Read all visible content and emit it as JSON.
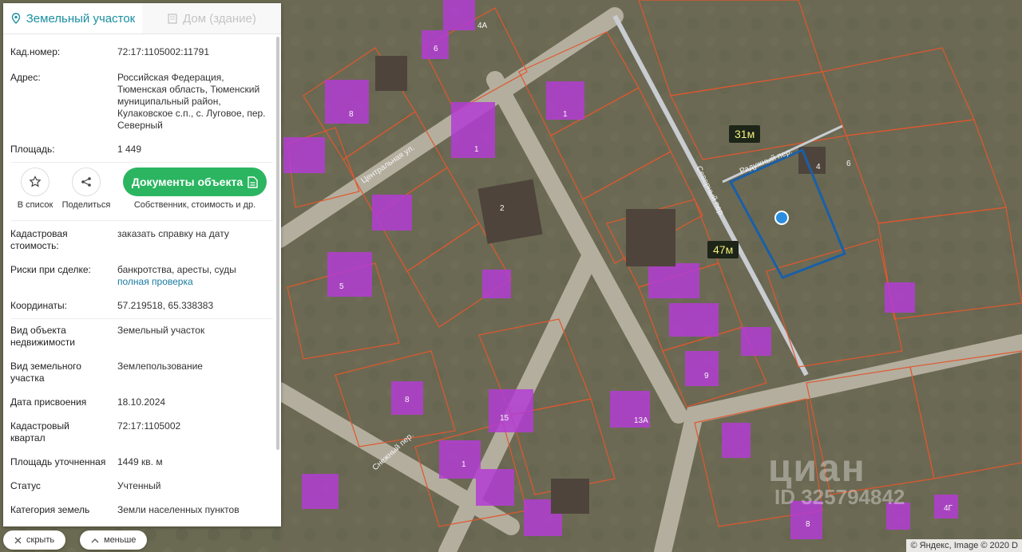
{
  "tabs": [
    {
      "label": "Земельный участок",
      "icon": "pin-icon",
      "active": true
    },
    {
      "label": "Дом (здание)",
      "icon": "building-icon",
      "active": false
    }
  ],
  "rows_top": [
    {
      "key": "Кад.номер:",
      "value": "72:17:1105002:11791",
      "link": true
    },
    {
      "key": "Адрес:",
      "value": "Российская Федерация, Тюменская область, Тюменский муниципальный район, Кулаковское с.п., с. Луговое, пер. Северный"
    },
    {
      "key": "Площадь:",
      "value": "1 449"
    }
  ],
  "actions": {
    "favorite_label": "В список",
    "share_label": "Поделиться",
    "documents_label": "Документы объекта",
    "documents_sub": "Собственник, стоимость и др."
  },
  "cadastral_value": {
    "key": "Кадастровая стоимость:",
    "link": "заказать справку на дату"
  },
  "risks": {
    "key": "Риски при сделке:",
    "value": "банкротства, аресты, суды",
    "link": "полная проверка"
  },
  "coords": {
    "key": "Координаты:",
    "value": "57.219518, 65.338383"
  },
  "rows_bottom": [
    {
      "key": "Вид объекта недвижимости",
      "value": "Земельный участок"
    },
    {
      "key": "Вид земельного участка",
      "value": "Землепользование"
    },
    {
      "key": "Дата присвоения",
      "value": "18.10.2024"
    },
    {
      "key": "Кадастровый квартал",
      "value": "72:17:1105002"
    },
    {
      "key": "Площадь уточненная",
      "value": "1449 кв. м"
    },
    {
      "key": "Статус",
      "value": "Учтенный"
    },
    {
      "key": "Категория земель",
      "value": "Земли населенных пунктов"
    }
  ],
  "controls": {
    "hide_label": "скрыть",
    "less_label": "меньше"
  },
  "map": {
    "label_width": "31м",
    "label_length": "47м",
    "streets": [
      "Центральная ул.",
      "Северный пер.",
      "Снежный пер.",
      "Радужный пер."
    ],
    "house_numbers": [
      "6",
      "8",
      "1",
      "1",
      "2",
      "5",
      "9",
      "8",
      "15",
      "13А",
      "1",
      "8",
      "4",
      "6",
      "4А",
      "4Г"
    ],
    "copyright": "© Яндекс, Image © 2020 D",
    "watermark": "циан",
    "watermark_id": "ID 325794842",
    "colors": {
      "parcel_border": "#e0572e",
      "building": "#b33dd4",
      "selected": "#1a5fa8",
      "road": "#b9b4a4"
    }
  }
}
